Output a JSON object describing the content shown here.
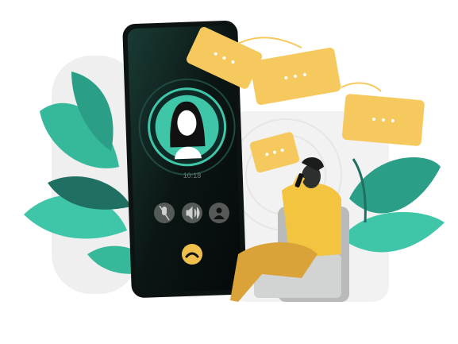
{
  "call_screen": {
    "time": "10:18",
    "buttons": [
      {
        "icon": "mute-mic-icon"
      },
      {
        "icon": "speaker-icon"
      },
      {
        "icon": "add-contact-icon"
      }
    ],
    "end_call_icon": "hang-up-icon"
  },
  "colors": {
    "accent_teal": "#3fc5a8",
    "bubble_yellow": "#f6c95e",
    "phone_body": "#0c1312",
    "end_call": "#f0c04c",
    "shirt_yellow": "#f3c43f"
  }
}
